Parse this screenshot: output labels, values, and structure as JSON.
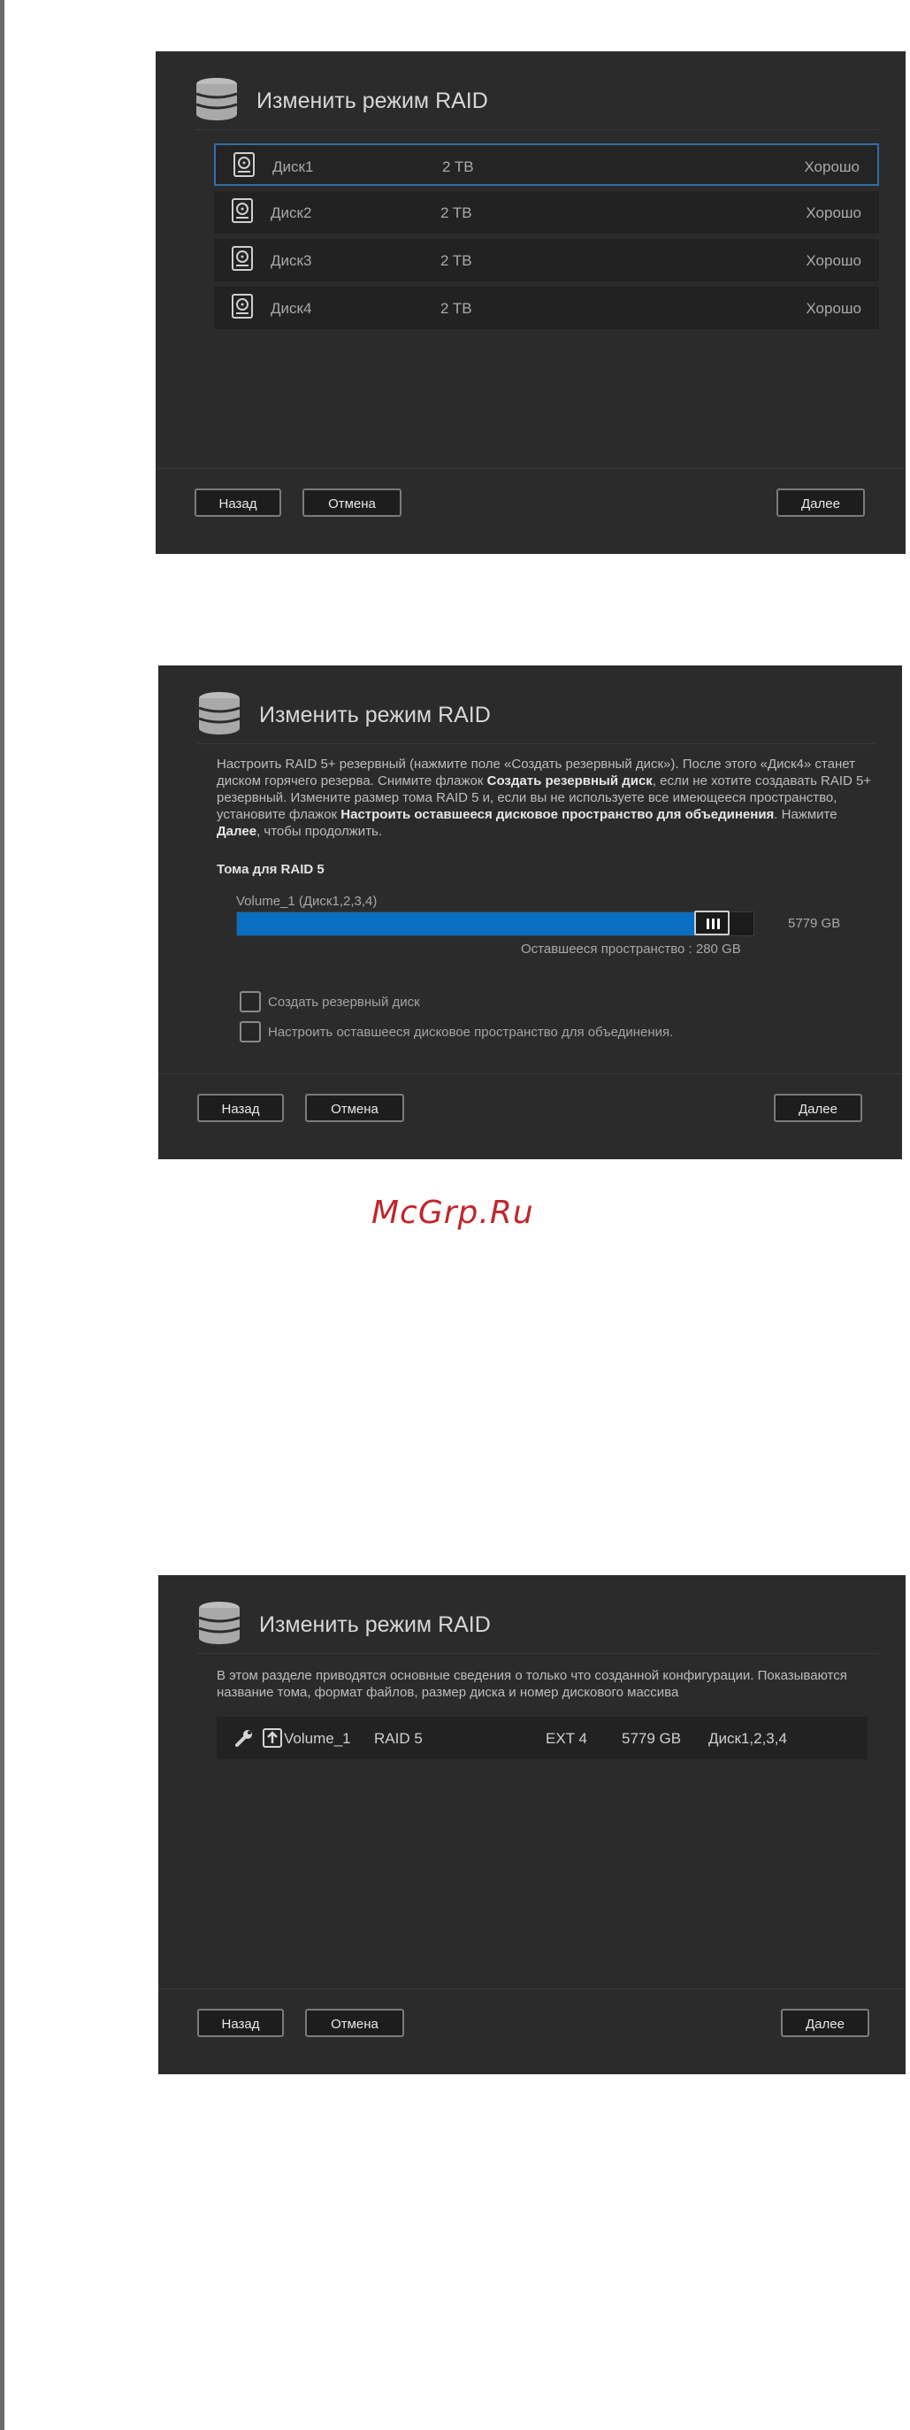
{
  "watermark": "McGrp.Ru",
  "panel1": {
    "title": "Изменить режим RAID",
    "disks": [
      {
        "name": "Диск1",
        "size": "2 TB",
        "status": "Хорошо"
      },
      {
        "name": "Диск2",
        "size": "2 TB",
        "status": "Хорошо"
      },
      {
        "name": "Диск3",
        "size": "2 TB",
        "status": "Хорошо"
      },
      {
        "name": "Диск4",
        "size": "2 TB",
        "status": "Хорошо"
      }
    ],
    "back": "Назад",
    "cancel": "Отмена",
    "next": "Далее"
  },
  "panel2": {
    "title": "Изменить режим RAID",
    "desc": {
      "p1": "Настроить RAID 5+ резервный (нажмите поле «Создать резервный диск»). После этого «Диск4» станет диском горячего резерва. Снимите флажок ",
      "b1": "Создать резервный диск",
      "p2": ", если не хотите создавать RAID 5+ резервный. Измените размер тома RAID 5 и, если вы не используете все имеющееся пространство, установите флажок ",
      "b2": "Настроить оставшееся дисковое пространство для объединения",
      "p3": ". Нажмите ",
      "b3": "Далее",
      "p4": ", чтобы продолжить."
    },
    "section": "Тома для RAID 5",
    "volume_label": "Volume_1 (Диск1,2,3,4)",
    "volume_size": "5779 GB",
    "slider_fraction": 0.95,
    "remaining": "Оставшееся пространство : 280 GB",
    "chk_spare": "Создать резервный диск",
    "chk_spanning": "Настроить оставшееся дисковое пространство для объединения.",
    "back": "Назад",
    "cancel": "Отмена",
    "next": "Далее"
  },
  "panel3": {
    "title": "Изменить режим RAID",
    "desc": "В этом разделе приводятся основные сведения о только что созданной конфигурации. Показываются название тома, формат файлов, размер диска и номер дискового массива",
    "row": {
      "volume": "Volume_1",
      "raid": "RAID 5",
      "fs": "EXT 4",
      "size": "5779 GB",
      "disks": "Диск1,2,3,4"
    },
    "back": "Назад",
    "cancel": "Отмена",
    "next": "Далее"
  },
  "colors": {
    "panel_bg": "#2b2b2b",
    "accent_blue": "#0a6fc0",
    "watermark_red": "#c0262c"
  }
}
